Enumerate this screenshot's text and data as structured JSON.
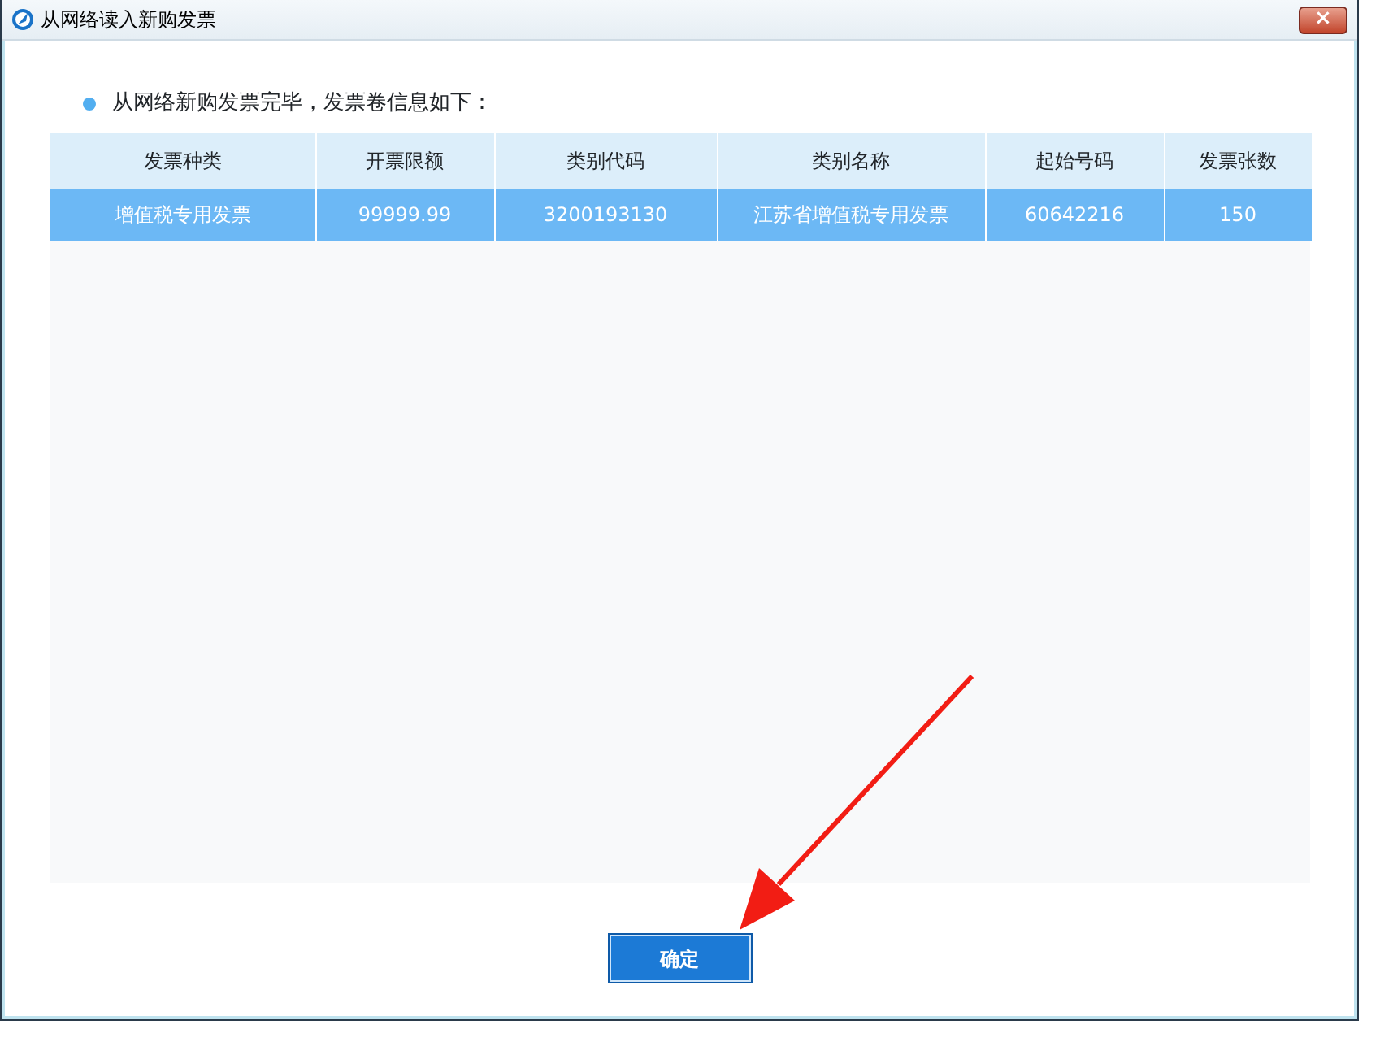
{
  "window": {
    "title": "从网络读入新购发票",
    "close_label": "×"
  },
  "message": "从网络新购发票完毕，发票卷信息如下：",
  "table": {
    "columns": [
      "发票种类",
      "开票限额",
      "类别代码",
      "类别名称",
      "起始号码",
      "发票张数"
    ],
    "rows": [
      {
        "selected": true,
        "cells": [
          "增值税专用发票",
          "99999.99",
          "3200193130",
          "江苏省增值税专用发票",
          "60642216",
          "150"
        ]
      }
    ]
  },
  "buttons": [
    "确定"
  ]
}
